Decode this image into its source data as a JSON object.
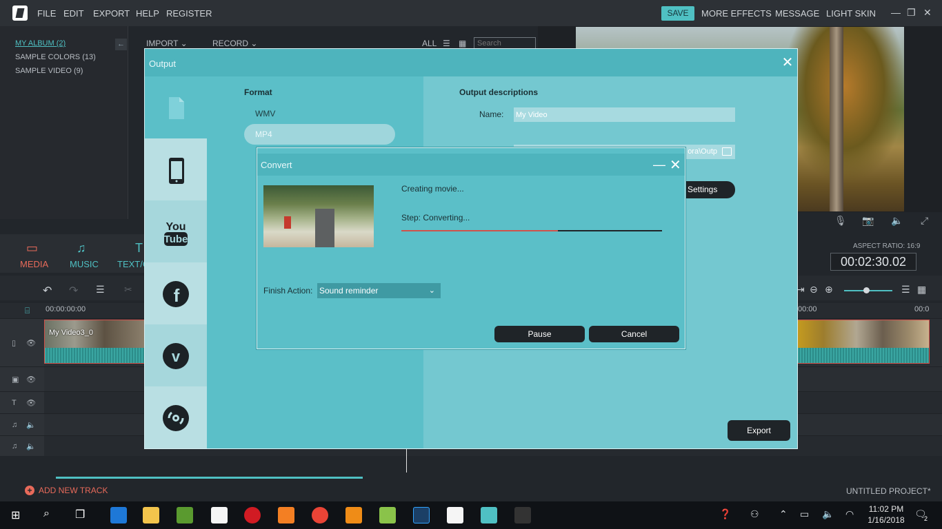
{
  "editor": {
    "menu": [
      "FILE",
      "EDIT",
      "EXPORT",
      "HELP",
      "REGISTER"
    ],
    "save_label": "SAVE",
    "right_menu": [
      "MORE EFFECTS",
      "MESSAGE",
      "LIGHT SKIN"
    ],
    "library": [
      "MY ALBUM (2)",
      "SAMPLE COLORS (13)",
      "SAMPLE VIDEO (9)"
    ],
    "media_links": {
      "import": "IMPORT",
      "record": "RECORD",
      "all": "ALL"
    },
    "search_placeholder": "Search",
    "tabs": [
      "MEDIA",
      "MUSIC",
      "TEXT/C"
    ],
    "aspect_ratio": "ASPECT RATIO: 16:9",
    "timecode": "00:02:30.02",
    "ruler_start": "00:00:00:00",
    "ruler_right_1": "00:00",
    "ruler_right_2": "00:0",
    "clip_label": "My Video3_0",
    "add_track": "ADD NEW TRACK",
    "project_name": "UNTITLED PROJECT*"
  },
  "output_dialog": {
    "title": "Output",
    "format_heading": "Format",
    "formats": [
      "WMV",
      "MP4"
    ],
    "selected_format": "MP4",
    "desc_heading": "Output descriptions",
    "name_label": "Name:",
    "name_value": "My Video",
    "path_value": "ora\\Outp",
    "settings_label": "Settings",
    "export_label": "Export"
  },
  "convert_dialog": {
    "title": "Convert",
    "status": "Creating movie...",
    "step": "Step: Converting...",
    "progress": 0.6,
    "finish_label": "Finish Action:",
    "finish_value": "Sound reminder",
    "pause_label": "Pause",
    "cancel_label": "Cancel"
  },
  "taskbar": {
    "time": "11:02 PM",
    "date": "1/16/2018",
    "notifications": "2"
  },
  "colors": {
    "accent_teal": "#4fc0c3",
    "dialog_teal": "#5bbfc8",
    "accent_red": "#e86a5a",
    "progress_red": "#d2514a"
  }
}
